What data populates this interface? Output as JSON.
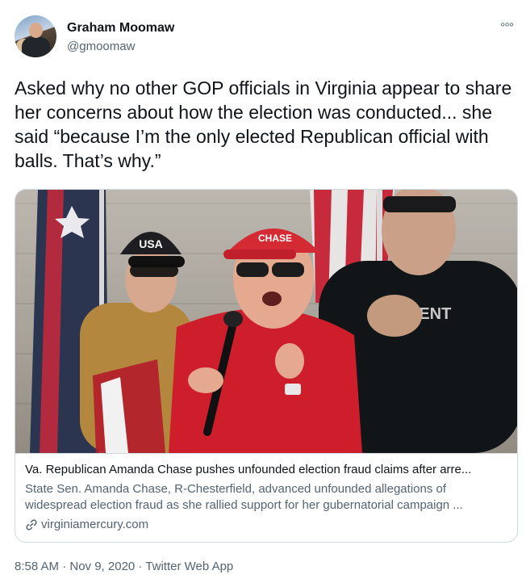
{
  "author": {
    "name": "Graham Moomaw",
    "handle": "@gmoomaw"
  },
  "tweet": {
    "text": "Asked why no other GOP officials in Virginia appear to share her concerns about how the election was conducted... she said “because I’m the only elected Republican official with balls. That’s why.”",
    "more_icon": "°°°"
  },
  "card": {
    "image_alt": "Amanda Chase speaking into a microphone at a rally, wearing a red CHASE cap, with supporters and American flags behind her",
    "cap_text": "CHASE",
    "title": "Va. Republican Amanda Chase pushes unfounded election fraud claims after arre...",
    "description": "State Sen. Amanda Chase, R-Chesterfield, advanced unfounded allegations of widespread election fraud as she rallied support for her gubernatorial campaign ...",
    "domain": "virginiamercury.com"
  },
  "footer": {
    "meta": "8:58 AM · Nov 9, 2020 · Twitter Web App"
  },
  "colors": {
    "text": "#0f1419",
    "secondary": "#536471",
    "border": "#cfd9de",
    "cap_red": "#d42a34"
  }
}
